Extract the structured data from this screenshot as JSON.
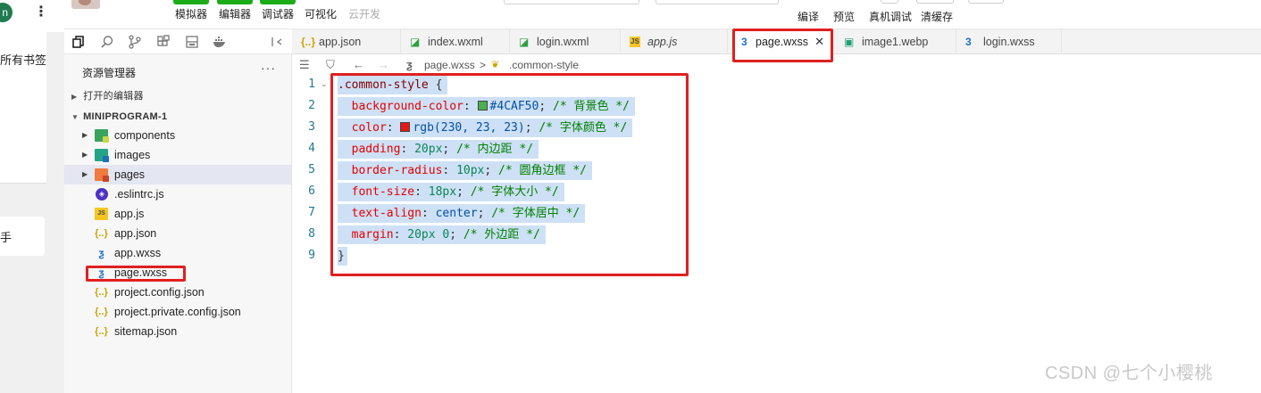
{
  "browser_strip": {
    "avatar_letter": "n",
    "menu_glyph": "⋮",
    "bookmarks_text": "所有书签",
    "hand_text": "手"
  },
  "toolbar": {
    "mode_buttons": [
      {
        "label": "模拟器"
      },
      {
        "label": "编辑器"
      },
      {
        "label": "调试器"
      },
      {
        "label": "可视化"
      },
      {
        "label": "云开发"
      }
    ],
    "actions": [
      {
        "label": "编译"
      },
      {
        "label": "预览"
      },
      {
        "label": "真机调试"
      },
      {
        "label": "清缓存"
      }
    ]
  },
  "activity_bar": {
    "icons": [
      "copy-icon",
      "search-icon",
      "source-control-icon",
      "extensions-icon",
      "storage-icon",
      "docker-icon",
      "split-panel-icon",
      "collapse-icon"
    ]
  },
  "explorer": {
    "title": "资源管理器",
    "more": "···",
    "open_editors_label": "打开的编辑器",
    "project_label": "MINIPROGRAM-1",
    "tree": [
      {
        "name": "components",
        "type": "folder",
        "icon": "components-folder-icon"
      },
      {
        "name": "images",
        "type": "folder",
        "icon": "images-folder-icon"
      },
      {
        "name": "pages",
        "type": "folder",
        "icon": "pages-folder-icon"
      },
      {
        "name": ".eslintrc.js",
        "type": "file",
        "icon": "eslint-icon"
      },
      {
        "name": "app.js",
        "type": "file",
        "icon": "js-icon"
      },
      {
        "name": "app.json",
        "type": "file",
        "icon": "json-icon"
      },
      {
        "name": "app.wxss",
        "type": "file",
        "icon": "css-icon"
      },
      {
        "name": "page.wxss",
        "type": "file",
        "icon": "css-icon"
      },
      {
        "name": "project.config.json",
        "type": "file",
        "icon": "json-icon"
      },
      {
        "name": "project.private.config.json",
        "type": "file",
        "icon": "json-icon"
      },
      {
        "name": "sitemap.json",
        "type": "file",
        "icon": "json-icon"
      }
    ]
  },
  "tabs": [
    {
      "label": "app.json",
      "icon": "{..}"
    },
    {
      "label": "index.wxml",
      "icon": "◪"
    },
    {
      "label": "login.wxml",
      "icon": "◪"
    },
    {
      "label": "app.js",
      "icon": "JS"
    },
    {
      "label": "page.wxss",
      "icon": "3",
      "active": true,
      "close": "✕"
    },
    {
      "label": "image1.webp",
      "icon": "▣"
    },
    {
      "label": "login.wxss",
      "icon": "3"
    }
  ],
  "breadcrumb": {
    "file": "page.wxss",
    "separator": ">",
    "symbol": ".common-style"
  },
  "editor": {
    "line_numbers": [
      "1",
      "2",
      "3",
      "4",
      "5",
      "6",
      "7",
      "8",
      "9"
    ],
    "lines": {
      "l1": {
        "selector": ".common-style",
        "brace": " {"
      },
      "l2": {
        "prop": "background-color",
        "colon": ": ",
        "value": "#4CAF50",
        "semi": ";",
        "comment": "/* 背景色 */",
        "swatch": "#4CAF50"
      },
      "l3": {
        "prop": "color",
        "colon": ": ",
        "value": "rgb(230, 23, 23)",
        "semi": ";",
        "comment": "/* 字体颜色 */",
        "swatch": "#e61717"
      },
      "l4": {
        "prop": "padding",
        "colon": ": ",
        "value": "20px",
        "semi": ";",
        "comment": "/* 内边距 */"
      },
      "l5": {
        "prop": "border-radius",
        "colon": ": ",
        "value": "10px",
        "semi": ";",
        "comment": "/* 圆角边框 */"
      },
      "l6": {
        "prop": "font-size",
        "colon": ": ",
        "value": "18px",
        "semi": ";",
        "comment": "/* 字体大小 */"
      },
      "l7": {
        "prop": "text-align",
        "colon": ": ",
        "value": "center",
        "semi": ";",
        "comment": "/* 字体居中 */"
      },
      "l8": {
        "prop": "margin",
        "colon": ": ",
        "value": "20px 0",
        "semi": ";",
        "comment": "/* 外边距 */"
      },
      "l9": {
        "brace": "}"
      }
    }
  },
  "colors": {
    "accent_green": "#1aad19",
    "highlight_red": "#e02020",
    "selection": "#cde0f5"
  },
  "watermark": "CSDN @七个小樱桃"
}
